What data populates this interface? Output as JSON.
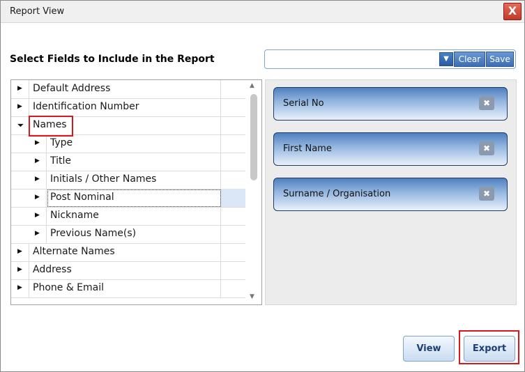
{
  "window": {
    "title": "Report View",
    "close_label": "X"
  },
  "heading": "Select Fields to Include in the Report",
  "combo": {
    "value": "",
    "arrow": "▼",
    "clear_label": "Clear",
    "save_label": "Save"
  },
  "tree": {
    "rows": [
      {
        "label": "Default Address",
        "expanded": false,
        "level": 0
      },
      {
        "label": "Identification Number",
        "expanded": false,
        "level": 0
      },
      {
        "label": "Names",
        "expanded": true,
        "level": 0
      },
      {
        "label": "Type",
        "expanded": false,
        "level": 1
      },
      {
        "label": "Title",
        "expanded": false,
        "level": 1
      },
      {
        "label": "Initials / Other Names",
        "expanded": false,
        "level": 1
      },
      {
        "label": "Post Nominal",
        "expanded": false,
        "level": 1,
        "focused": true
      },
      {
        "label": "Nickname",
        "expanded": false,
        "level": 1
      },
      {
        "label": "Previous Name(s)",
        "expanded": false,
        "level": 1
      },
      {
        "label": "Alternate Names",
        "expanded": false,
        "level": 0
      },
      {
        "label": "Address",
        "expanded": false,
        "level": 0
      },
      {
        "label": "Phone & Email",
        "expanded": false,
        "level": 0
      }
    ],
    "collapsed_glyph": "▶",
    "expanded_glyph": "◢"
  },
  "selected_fields": [
    {
      "label": "Serial No",
      "remove": "✖"
    },
    {
      "label": "First Name",
      "remove": "✖"
    },
    {
      "label": "Surname / Organisation",
      "remove": "✖"
    }
  ],
  "footer": {
    "view_label": "View",
    "export_label": "Export"
  },
  "colors": {
    "accent": "#3c6eb5",
    "highlight_box": "#d7191f"
  }
}
